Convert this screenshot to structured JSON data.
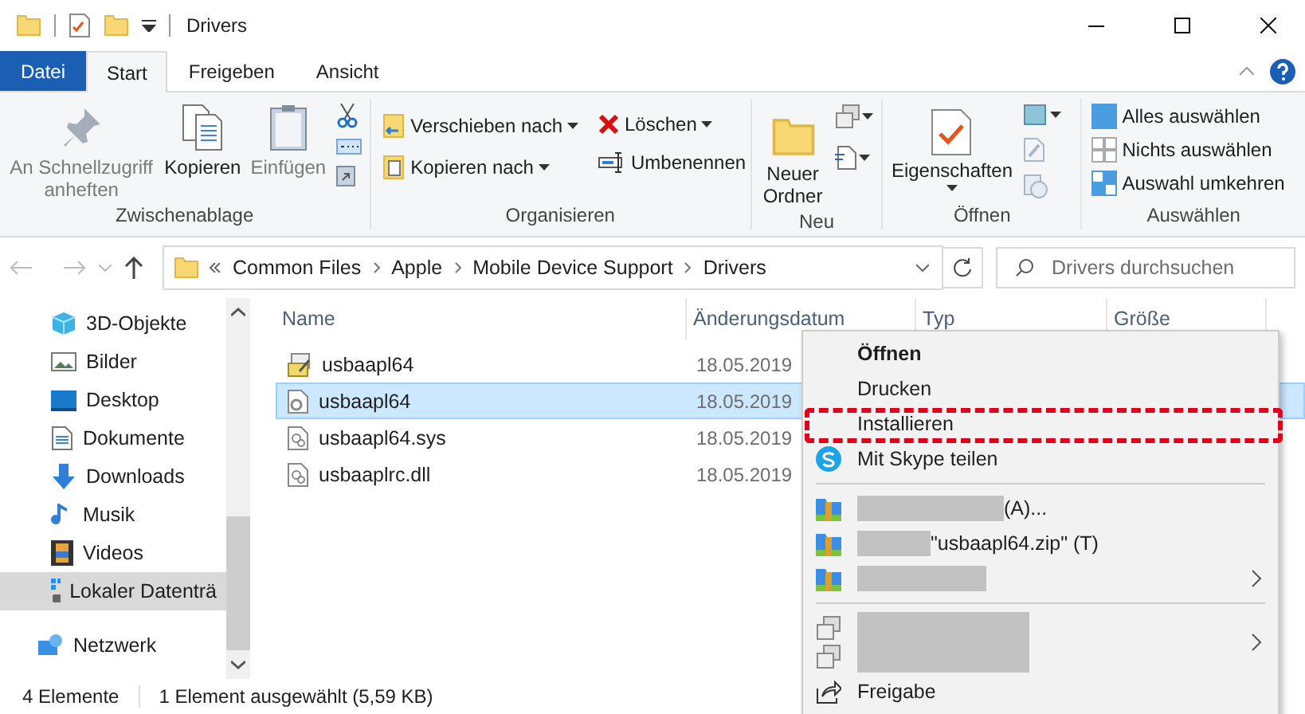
{
  "window": {
    "title": "Drivers"
  },
  "ribbon_tabs": [
    {
      "label": "Datei",
      "kind": "file",
      "selected": false
    },
    {
      "label": "Start",
      "kind": "tab",
      "selected": true
    },
    {
      "label": "Freigeben",
      "kind": "tab",
      "selected": false
    },
    {
      "label": "Ansicht",
      "kind": "tab",
      "selected": false
    }
  ],
  "clipboard": {
    "label": "Zwischenablage",
    "buttons": [
      {
        "label": "An Schnellzugriff anheften",
        "kind": "pin",
        "disabled": true
      },
      {
        "label": "Kopieren",
        "kind": "copy",
        "disabled": false
      },
      {
        "label": "Einfügen",
        "kind": "paste",
        "disabled": true
      }
    ]
  },
  "organize": {
    "label": "Organisieren",
    "buttons": [
      {
        "label": "Verschieben nach",
        "kind": "move",
        "dropdown": true
      },
      {
        "label": "Kopieren nach",
        "kind": "copyto",
        "dropdown": true
      },
      {
        "label": "Löschen",
        "kind": "delete",
        "dropdown": true
      },
      {
        "label": "Umbenennen",
        "kind": "rename",
        "dropdown": false
      }
    ]
  },
  "new": {
    "label": "Neu",
    "button": "Neuer Ordner"
  },
  "open": {
    "label": "Öffnen",
    "button": "Eigenschaften"
  },
  "select": {
    "label": "Auswählen",
    "buttons": [
      {
        "label": "Alles auswählen",
        "kind": "all"
      },
      {
        "label": "Nichts auswählen",
        "kind": "none"
      },
      {
        "label": "Auswahl umkehren",
        "kind": "invert"
      }
    ]
  },
  "breadcrumb": [
    "Common Files",
    "Apple",
    "Mobile Device Support",
    "Drivers"
  ],
  "search": {
    "placeholder": "Drivers durchsuchen"
  },
  "nav": {
    "items": [
      {
        "label": "3D-Objekte",
        "kind": "cube",
        "selected": false
      },
      {
        "label": "Bilder",
        "kind": "pictures",
        "selected": false
      },
      {
        "label": "Desktop",
        "kind": "desktop",
        "selected": false
      },
      {
        "label": "Dokumente",
        "kind": "documents",
        "selected": false
      },
      {
        "label": "Downloads",
        "kind": "downloads",
        "selected": false
      },
      {
        "label": "Musik",
        "kind": "music",
        "selected": false
      },
      {
        "label": "Videos",
        "kind": "videos",
        "selected": false
      },
      {
        "label": "Lokaler Datenträ",
        "kind": "drive",
        "selected": true
      }
    ],
    "network": "Netzwerk"
  },
  "columns": [
    "Name",
    "Änderungsdatum",
    "Typ",
    "Größe"
  ],
  "files": [
    {
      "name": "usbaapl64",
      "date": "18.05.2019",
      "kind": "setup",
      "selected": false
    },
    {
      "name": "usbaapl64",
      "date": "18.05.2019",
      "kind": "config",
      "selected": true
    },
    {
      "name": "usbaapl64.sys",
      "date": "18.05.2019",
      "kind": "system",
      "selected": false
    },
    {
      "name": "usbaaplrc.dll",
      "date": "18.05.2019",
      "kind": "system",
      "selected": false
    }
  ],
  "status_bar": {
    "count": "4 Elemente",
    "selection": "1 Element ausgewählt (5,59 KB)"
  },
  "context_menu": [
    {
      "kind": "plain",
      "label": "Öffnen",
      "bold": true,
      "highlighted": false
    },
    {
      "kind": "plain",
      "label": "Drucken",
      "bold": false,
      "highlighted": false
    },
    {
      "kind": "plain",
      "label": "Installieren",
      "bold": false,
      "highlighted": true
    },
    {
      "kind": "skype",
      "label": "Mit Skype teilen",
      "bold": false,
      "highlighted": false
    },
    {
      "kind": "separator"
    },
    {
      "kind": "archive",
      "label": "(A)...",
      "submenu": false
    },
    {
      "kind": "archive",
      "label": "\"usbaapl64.zip\" (T)",
      "submenu": false
    },
    {
      "kind": "archive",
      "submenu": true
    },
    {
      "kind": "separator"
    },
    {
      "kind": "hidden",
      "submenu": true
    },
    {
      "kind": "share",
      "label": "Freigabe",
      "bold": false,
      "highlighted": false
    }
  ]
}
